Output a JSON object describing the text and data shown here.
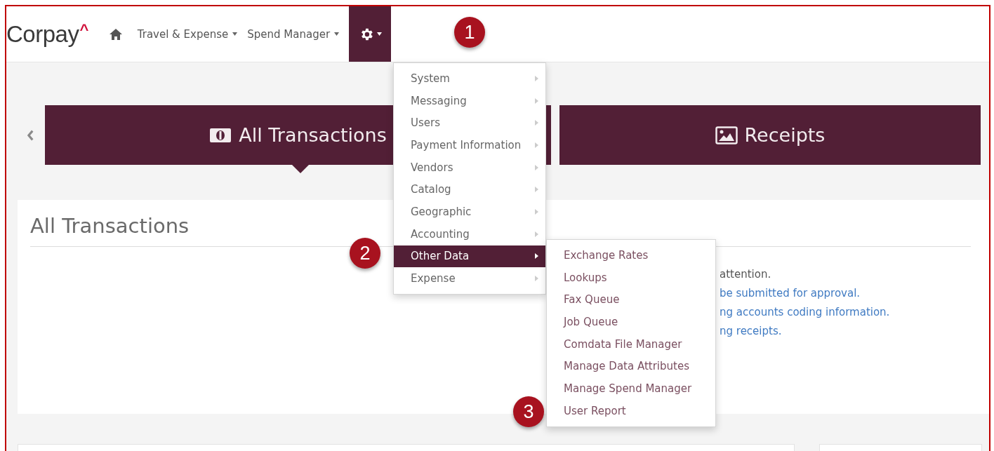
{
  "brand": {
    "name": "Corpay",
    "mark": "^"
  },
  "nav": [
    {
      "label": "Travel & Expense"
    },
    {
      "label": "Spend Manager"
    }
  ],
  "settings": {
    "open": true
  },
  "tabs": [
    {
      "label": "All Transactions",
      "selected": true,
      "kind": "transactions"
    },
    {
      "label": "Receipts",
      "selected": false,
      "kind": "receipts"
    }
  ],
  "card": {
    "title": "All Transactions",
    "lines": [
      {
        "text": "attention.",
        "kind": "plain"
      },
      {
        "text": "be submitted for approval.",
        "kind": "link"
      },
      {
        "text": "ng accounts coding information.",
        "kind": "link"
      },
      {
        "text": "ng receipts.",
        "kind": "link"
      }
    ]
  },
  "menu": {
    "items": [
      {
        "label": "System",
        "selected": false
      },
      {
        "label": "Messaging",
        "selected": false
      },
      {
        "label": "Users",
        "selected": false
      },
      {
        "label": "Payment Information",
        "selected": false
      },
      {
        "label": "Vendors",
        "selected": false
      },
      {
        "label": "Catalog",
        "selected": false
      },
      {
        "label": "Geographic",
        "selected": false
      },
      {
        "label": "Accounting",
        "selected": false
      },
      {
        "label": "Other Data",
        "selected": true
      },
      {
        "label": "Expense",
        "selected": false
      }
    ]
  },
  "submenu": {
    "items": [
      {
        "label": "Exchange Rates"
      },
      {
        "label": "Lookups"
      },
      {
        "label": "Fax Queue"
      },
      {
        "label": "Job Queue"
      },
      {
        "label": "Comdata File Manager"
      },
      {
        "label": "Manage Data Attributes"
      },
      {
        "label": "Manage Spend Manager"
      },
      {
        "label": "User Report"
      }
    ]
  },
  "callouts": [
    "1",
    "2",
    "3"
  ]
}
